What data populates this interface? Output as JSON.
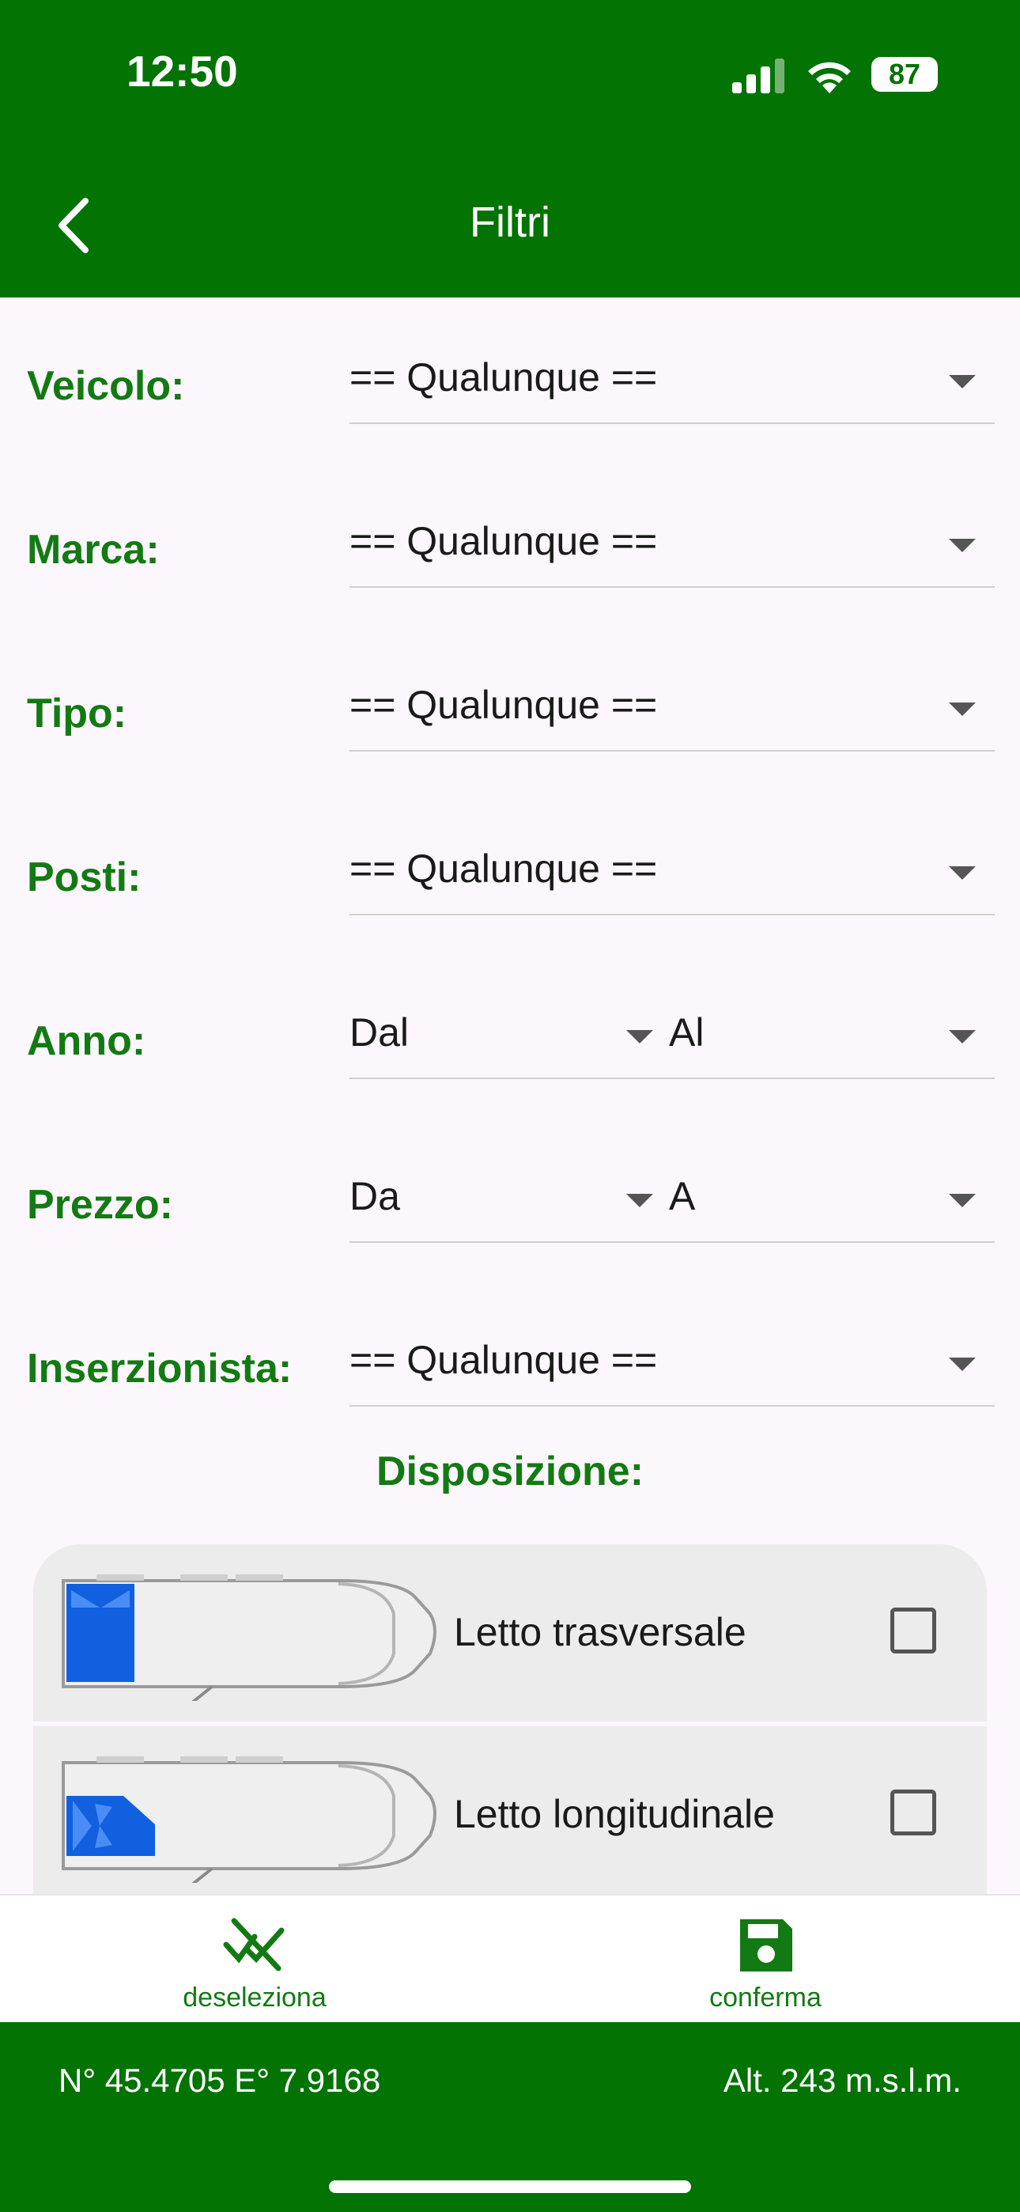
{
  "status_bar": {
    "time": "12:50",
    "battery": "87"
  },
  "nav": {
    "title": "Filtri"
  },
  "filters": {
    "veicolo": {
      "label": "Veicolo:",
      "value": "== Qualunque =="
    },
    "marca": {
      "label": "Marca:",
      "value": "== Qualunque =="
    },
    "tipo": {
      "label": "Tipo:",
      "value": "== Qualunque =="
    },
    "posti": {
      "label": "Posti:",
      "value": "== Qualunque =="
    },
    "anno": {
      "label": "Anno:",
      "from": "Dal",
      "to": "Al"
    },
    "prezzo": {
      "label": "Prezzo:",
      "from": "Da",
      "to": "A"
    },
    "inserzionista": {
      "label": "Inserzionista:",
      "value": "== Qualunque =="
    }
  },
  "disposizione": {
    "title": "Disposizione:",
    "options": [
      {
        "label": "Letto trasversale",
        "checked": false
      },
      {
        "label": "Letto longitudinale",
        "checked": false
      }
    ]
  },
  "toolbar": {
    "deselect_label": "deseleziona",
    "confirm_label": "conferma"
  },
  "footer": {
    "coords": "N° 45.4705 E° 7.9168",
    "altitude": "Alt. 243 m.s.l.m."
  },
  "colors": {
    "brand_green": "#037303",
    "label_green": "#137a13",
    "bed_blue": "#1060e0"
  }
}
